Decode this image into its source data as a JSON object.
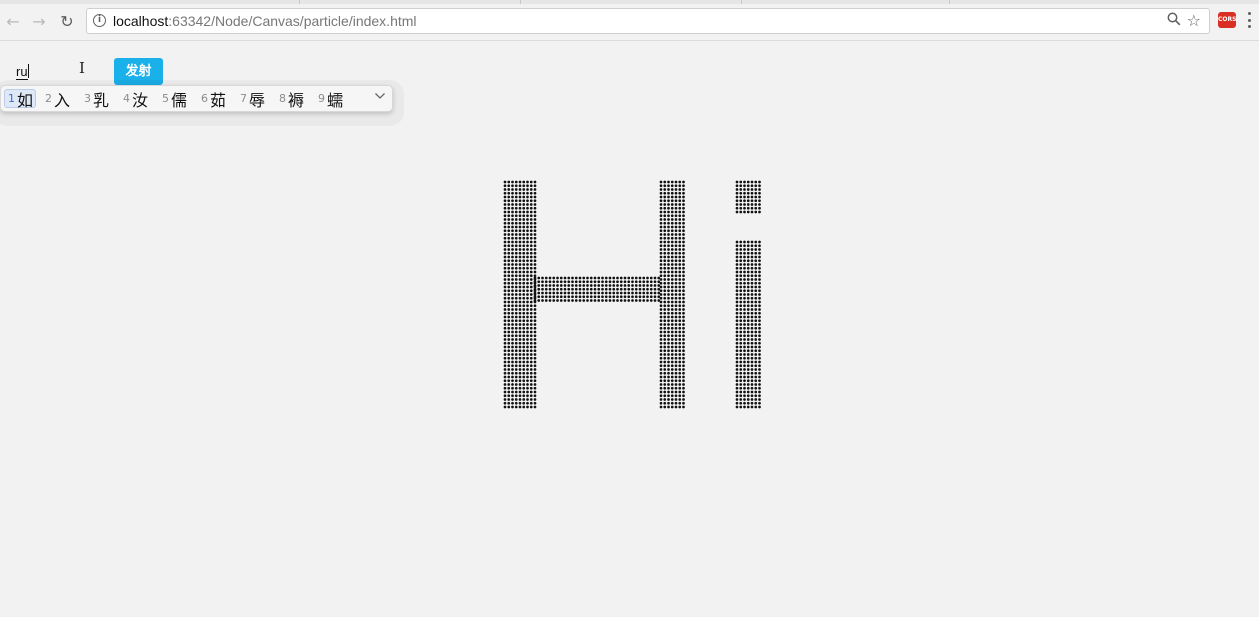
{
  "browser": {
    "back_icon": "←",
    "forward_icon": "→",
    "reload_icon": "↻",
    "info_icon": "i",
    "url_host": "localhost",
    "url_rest": ":63342/Node/Canvas/particle/index.html",
    "zoom_icon": "magnifier-icon",
    "star_icon": "☆",
    "extension_label": "CORS",
    "menu_icon": "kebab-menu-icon"
  },
  "form": {
    "input_value": "ru",
    "fire_button_label": "发射"
  },
  "ime": {
    "candidates": [
      {
        "num": "1",
        "char": "如"
      },
      {
        "num": "2",
        "char": "入"
      },
      {
        "num": "3",
        "char": "乳"
      },
      {
        "num": "4",
        "char": "汝"
      },
      {
        "num": "5",
        "char": "儒"
      },
      {
        "num": "6",
        "char": "茹"
      },
      {
        "num": "7",
        "char": "辱"
      },
      {
        "num": "8",
        "char": "褥"
      },
      {
        "num": "9",
        "char": "蠕"
      }
    ],
    "expand_icon": "⌄",
    "selected_index": 0
  },
  "canvas": {
    "particle_text": "Hi",
    "particle_color": "#111111",
    "background": "#f2f2f2"
  }
}
